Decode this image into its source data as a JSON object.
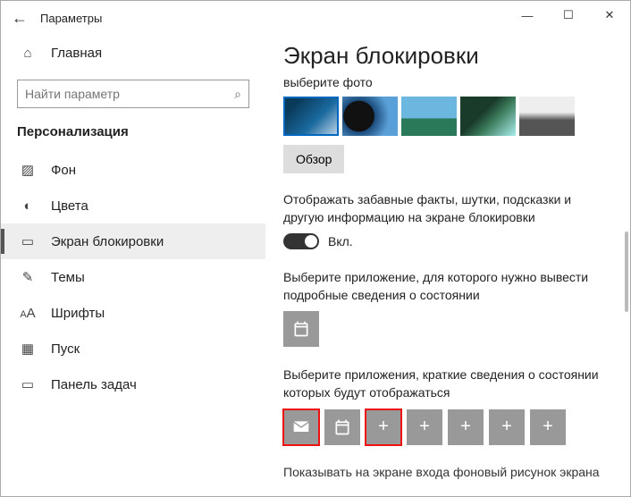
{
  "window": {
    "title": "Параметры"
  },
  "search": {
    "placeholder": "Найти параметр"
  },
  "sidebar": {
    "home": "Главная",
    "category": "Персонализация",
    "items": [
      {
        "label": "Фон"
      },
      {
        "label": "Цвета"
      },
      {
        "label": "Экран блокировки"
      },
      {
        "label": "Темы"
      },
      {
        "label": "Шрифты"
      },
      {
        "label": "Пуск"
      },
      {
        "label": "Панель задач"
      }
    ]
  },
  "main": {
    "heading": "Экран блокировки",
    "choose_photo": "выберите фото",
    "browse": "Обзор",
    "fun_facts": "Отображать забавные факты, шутки, подсказки и другую информацию на экране блокировки",
    "toggle_on": "Вкл.",
    "detailed_app": "Выберите приложение, для которого нужно вывести подробные сведения о состоянии",
    "quick_apps": "Выберите приложения, краткие сведения о состоянии которых будут отображаться",
    "show_bg_truncated": "Показывать на экране входа фоновый рисунок экрана"
  }
}
